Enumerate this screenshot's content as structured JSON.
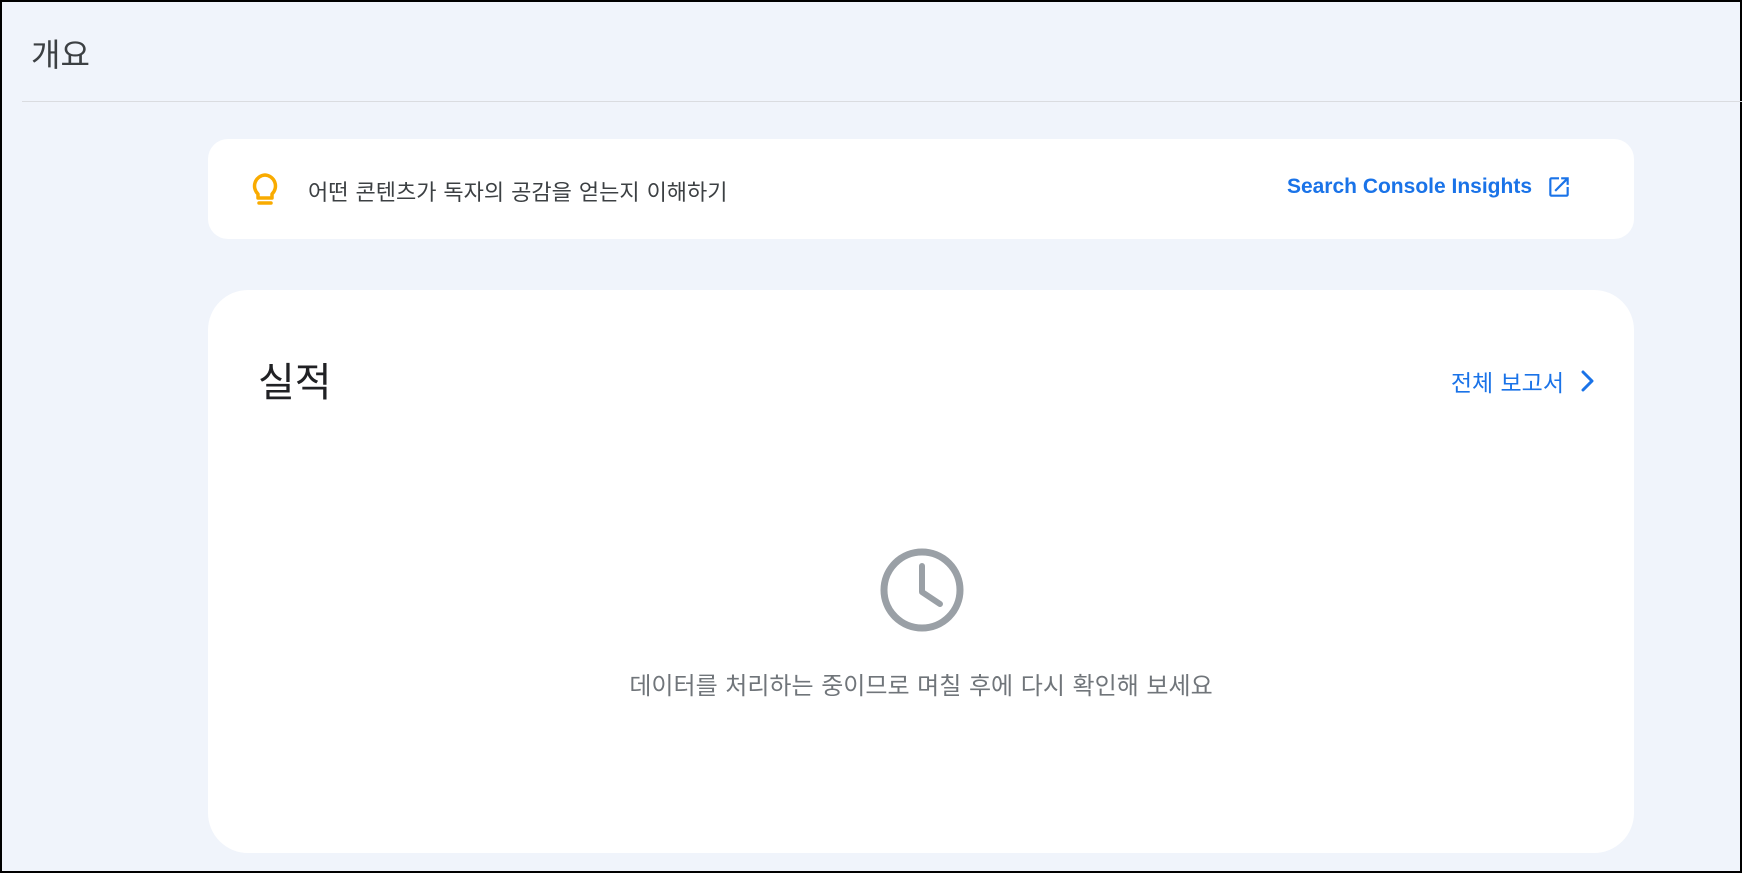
{
  "header": {
    "title": "개요"
  },
  "insights": {
    "icon": "lightbulb-icon",
    "text": "어떤 콘텐츠가 독자의 공감을 얻는지 이해하기",
    "link_label": "Search Console Insights",
    "link_icon": "open-in-new-icon"
  },
  "performance": {
    "title": "실적",
    "report_link_label": "전체 보고서",
    "report_link_icon": "chevron-right-icon",
    "status_icon": "clock-icon",
    "status_text": "데이터를 처리하는 중이므로 며칠 후에 다시 확인해 보세요"
  },
  "colors": {
    "page_bg": "#f0f4fb",
    "card_bg": "#ffffff",
    "link": "#1a73e8",
    "bulb": "#f9ab00",
    "muted": "#9aa0a6"
  }
}
